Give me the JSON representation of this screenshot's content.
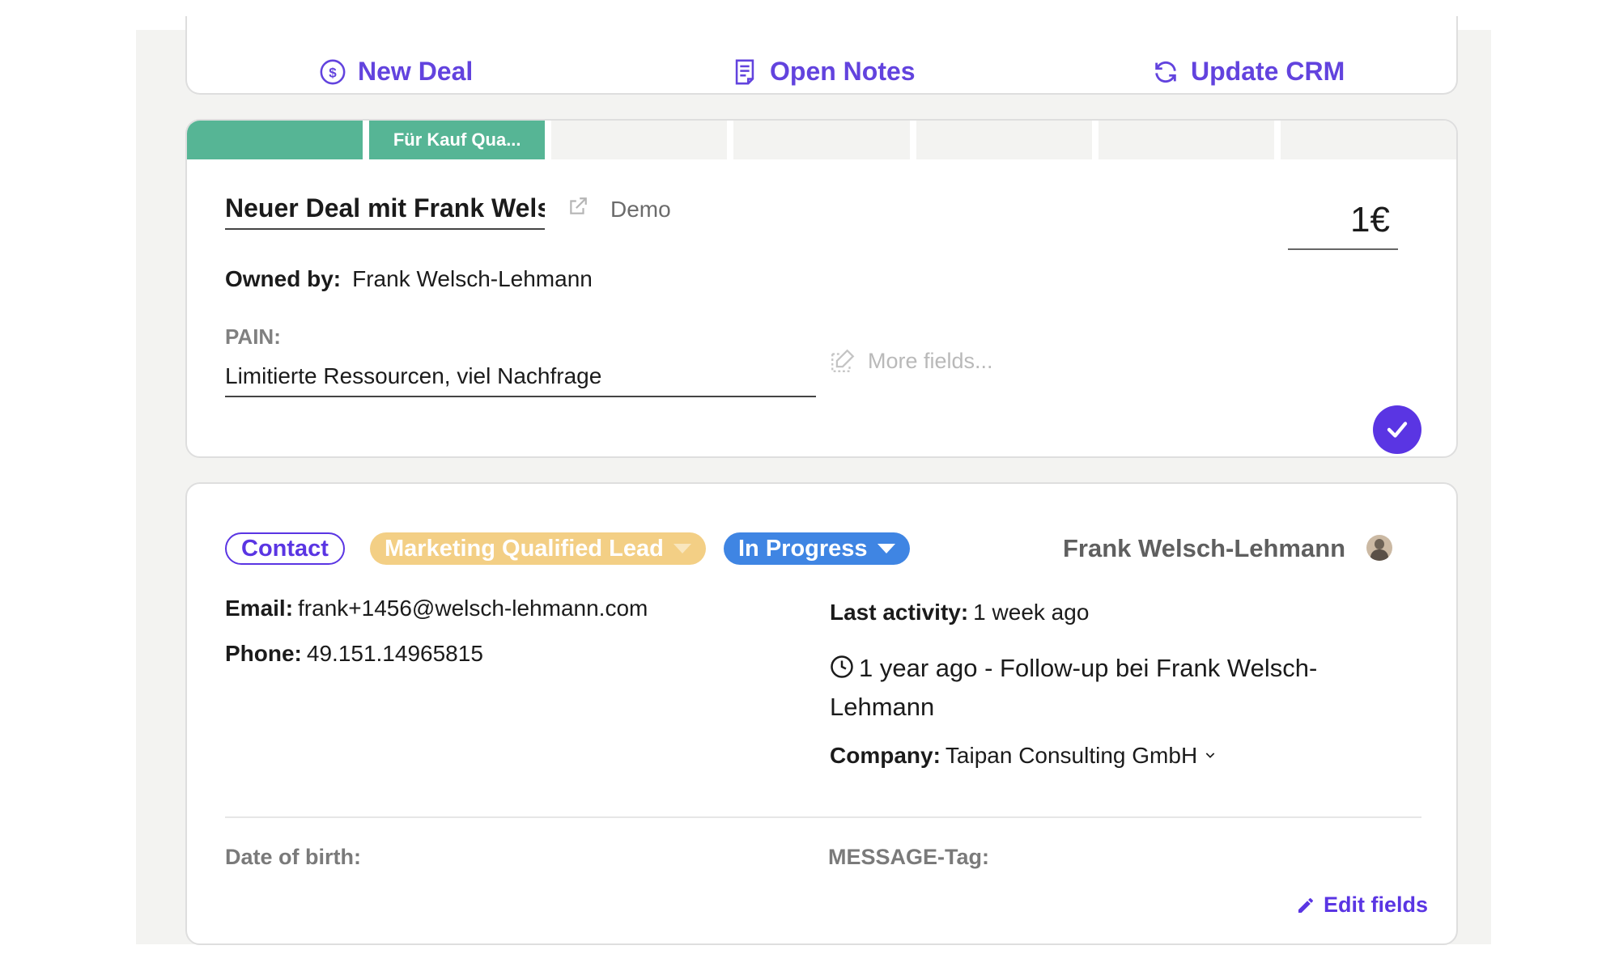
{
  "actions": {
    "new_deal": "New Deal",
    "open_notes": "Open Notes",
    "update_crm": "Update CRM"
  },
  "deal": {
    "stages": [
      "",
      "Für Kauf Qua...",
      "",
      "",
      "",
      "",
      ""
    ],
    "title": "Neuer Deal mit Frank Welsch-Lehmann",
    "type": "Demo",
    "amount": "1€",
    "owned_by_label": "Owned by:",
    "owned_by": "Frank Welsch-Lehmann",
    "pain_label": "PAIN:",
    "pain_value": "Limitierte Ressourcen, viel Nachfrage",
    "more_fields": "More fields..."
  },
  "contact": {
    "type_pill": "Contact",
    "lifecycle_pill": "Marketing Qualified Lead",
    "status_pill": "In Progress",
    "owner": "Frank Welsch-Lehmann",
    "email_label": "Email:",
    "email": "frank+1456@welsch-lehmann.com",
    "phone_label": "Phone:",
    "phone": "49.151.14965815",
    "last_activity_label": "Last activity:",
    "last_activity": "1 week ago",
    "activity_entry": "1 year ago - Follow-up bei Frank Welsch-Lehmann",
    "company_label": "Company:",
    "company": "Taipan Consulting GmbH",
    "dob_label": "Date of birth:",
    "message_tag_label": "MESSAGE-Tag:",
    "edit_fields": "Edit fields"
  },
  "colors": {
    "accent": "#5a35e3",
    "stage_done": "#56b595",
    "mql": "#f3cf85",
    "in_progress": "#3f85e3"
  }
}
